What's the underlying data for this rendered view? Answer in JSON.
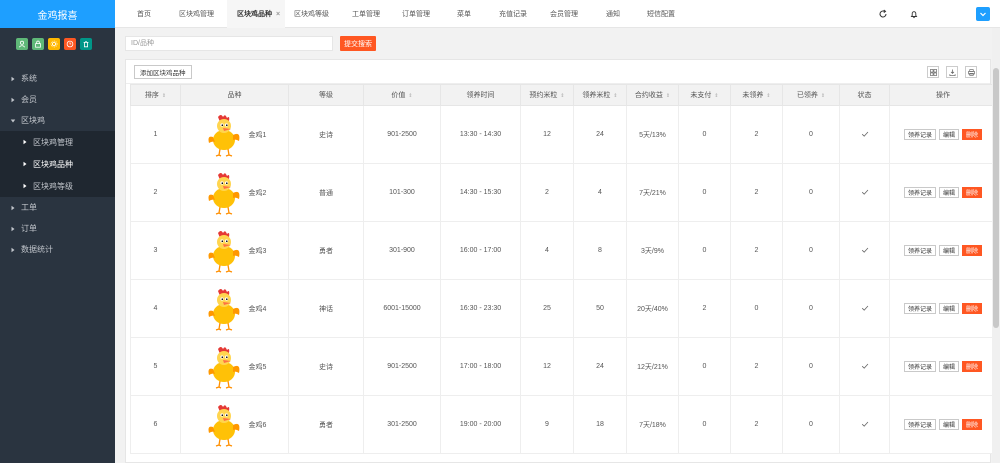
{
  "app": {
    "brand": "金鸡报喜"
  },
  "tabs": [
    {
      "label": "首页"
    },
    {
      "label": "区块鸡管理"
    },
    {
      "label": "区块鸡品种",
      "active": true
    },
    {
      "label": "区块鸡等级"
    },
    {
      "label": "工单管理"
    },
    {
      "label": "订单管理"
    },
    {
      "label": "菜单"
    },
    {
      "label": "充值记录"
    },
    {
      "label": "会员管理"
    },
    {
      "label": "通知"
    },
    {
      "label": "短信配置"
    }
  ],
  "tab_close": "×",
  "sidebar": {
    "quick_colors": [
      "#5fb878",
      "#5fb878",
      "#ffb800",
      "#ff5722",
      "#009688"
    ],
    "items": [
      {
        "label": "系统"
      },
      {
        "label": "会员"
      },
      {
        "label": "区块鸡",
        "expanded": true
      },
      {
        "label": "工单"
      },
      {
        "label": "订单"
      },
      {
        "label": "数据统计"
      }
    ],
    "sub_items": [
      {
        "label": "区块鸡管理"
      },
      {
        "label": "区块鸡品种",
        "active": true
      },
      {
        "label": "区块鸡等级"
      }
    ]
  },
  "search": {
    "placeholder": "ID/品种",
    "button": "提交搜索"
  },
  "toolbar": {
    "add_label": "添加区块鸡品种"
  },
  "table": {
    "headers": [
      "排序",
      "品种",
      "等级",
      "价值",
      "领养时间",
      "预约米粒",
      "领养米粒",
      "合约收益",
      "未支付",
      "未领养",
      "已领养",
      "状态",
      "操作"
    ],
    "rows": [
      {
        "sort": "1",
        "name": "金鸡1",
        "level": "史诗",
        "value": "901-2500",
        "time": "13:30 - 14:30",
        "reserve": "12",
        "adopt": "24",
        "profit": "5天/13%",
        "unpaid": "0",
        "unadopted": "2",
        "adopted": "0"
      },
      {
        "sort": "2",
        "name": "金鸡2",
        "level": "普通",
        "value": "101-300",
        "time": "14:30 - 15:30",
        "reserve": "2",
        "adopt": "4",
        "profit": "7天/21%",
        "unpaid": "0",
        "unadopted": "2",
        "adopted": "0"
      },
      {
        "sort": "3",
        "name": "金鸡3",
        "level": "勇者",
        "value": "301-900",
        "time": "16:00 - 17:00",
        "reserve": "4",
        "adopt": "8",
        "profit": "3天/9%",
        "unpaid": "0",
        "unadopted": "2",
        "adopted": "0"
      },
      {
        "sort": "4",
        "name": "金鸡4",
        "level": "神话",
        "value": "6001-15000",
        "time": "16:30 - 23:30",
        "reserve": "25",
        "adopt": "50",
        "profit": "20天/40%",
        "unpaid": "2",
        "unadopted": "0",
        "adopted": "0"
      },
      {
        "sort": "5",
        "name": "金鸡5",
        "level": "史诗",
        "value": "901-2500",
        "time": "17:00 - 18:00",
        "reserve": "12",
        "adopt": "24",
        "profit": "12天/21%",
        "unpaid": "0",
        "unadopted": "2",
        "adopted": "0"
      },
      {
        "sort": "6",
        "name": "金鸡6",
        "level": "勇者",
        "value": "301-2500",
        "time": "19:00 - 20:00",
        "reserve": "9",
        "adopt": "18",
        "profit": "7天/18%",
        "unpaid": "0",
        "unadopted": "2",
        "adopted": "0"
      }
    ],
    "ops": {
      "record": "领养记录",
      "edit": "编辑",
      "delete": "删除"
    }
  },
  "colors": {
    "accent": "#1e9fff",
    "danger": "#ff5722",
    "sidebar": "#2a3440"
  }
}
